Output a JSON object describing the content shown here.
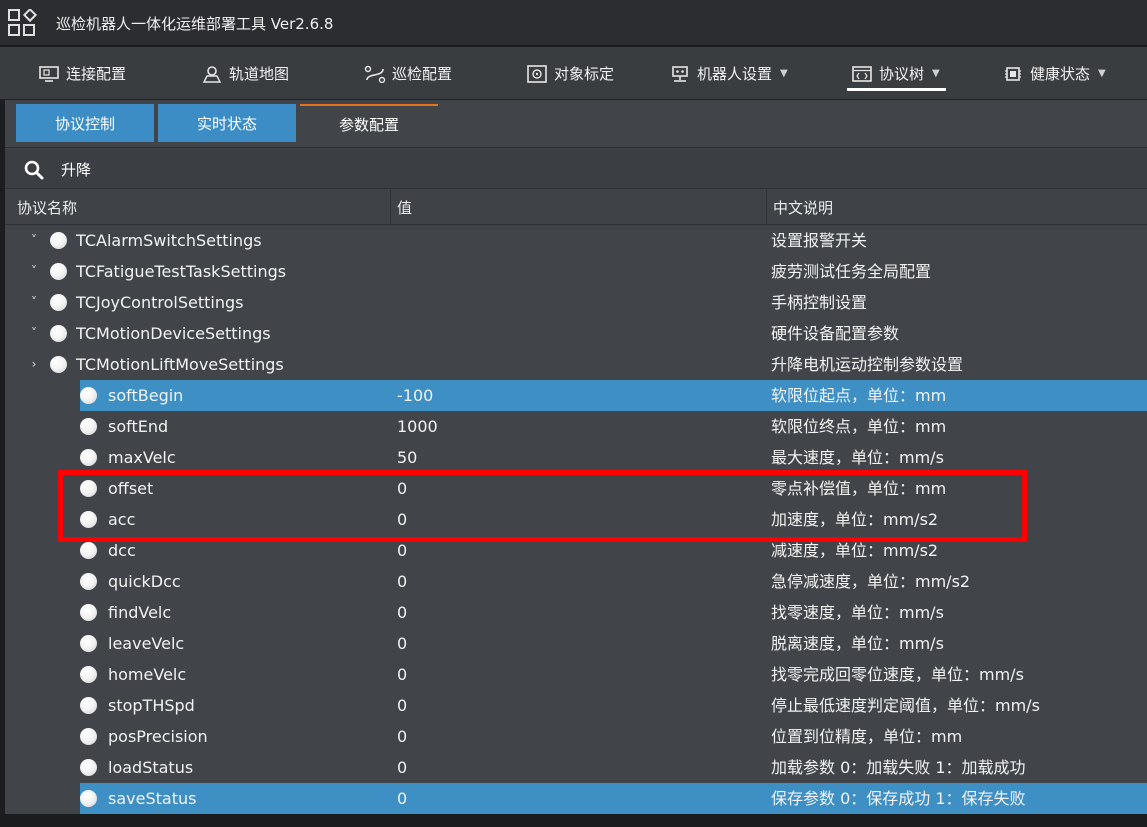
{
  "window": {
    "title": "巡检机器人一体化运维部署工具 Ver2.6.8"
  },
  "nav": [
    {
      "label": "连接配置",
      "icon": "monitor-icon",
      "dropdown": false,
      "active": false
    },
    {
      "label": "轨道地图",
      "icon": "map-pin-icon",
      "dropdown": false,
      "active": false
    },
    {
      "label": "巡检配置",
      "icon": "route-icon",
      "dropdown": false,
      "active": false
    },
    {
      "label": "对象标定",
      "icon": "target-icon",
      "dropdown": false,
      "active": false
    },
    {
      "label": "机器人设置",
      "icon": "robot-icon",
      "dropdown": true,
      "active": false
    },
    {
      "label": "协议树",
      "icon": "code-window-icon",
      "dropdown": true,
      "active": true
    },
    {
      "label": "健康状态",
      "icon": "chip-icon",
      "dropdown": true,
      "active": false
    }
  ],
  "subtabs": [
    {
      "label": "协议控制"
    },
    {
      "label": "实时状态"
    },
    {
      "label": "参数配置"
    }
  ],
  "search": {
    "value": "升降",
    "placeholder": ""
  },
  "table": {
    "headers": {
      "name": "协议名称",
      "value": "值",
      "desc": "中文说明"
    },
    "rows": [
      {
        "level": 0,
        "expand": "˅",
        "name": "TCAlarmSwitchSettings",
        "value": "",
        "desc": "设置报警开关"
      },
      {
        "level": 0,
        "expand": "˅",
        "name": "TCFatigueTestTaskSettings",
        "value": "",
        "desc": "疲劳测试任务全局配置"
      },
      {
        "level": 0,
        "expand": "˅",
        "name": "TCJoyControlSettings",
        "value": "",
        "desc": "手柄控制设置"
      },
      {
        "level": 0,
        "expand": "˅",
        "name": "TCMotionDeviceSettings",
        "value": "",
        "desc": "硬件设备配置参数"
      },
      {
        "level": 0,
        "expand": "›",
        "name": "TCMotionLiftMoveSettings",
        "value": "",
        "desc": "升降电机运动控制参数设置"
      },
      {
        "level": 1,
        "name": "softBegin",
        "value": "-100",
        "desc": "软限位起点，单位：mm",
        "selected": true
      },
      {
        "level": 1,
        "name": "softEnd",
        "value": "1000",
        "desc": "软限位终点，单位：mm"
      },
      {
        "level": 1,
        "name": "maxVelc",
        "value": "50",
        "desc": "最大速度，单位：mm/s"
      },
      {
        "level": 1,
        "name": "offset",
        "value": "0",
        "desc": "零点补偿值，单位：mm"
      },
      {
        "level": 1,
        "name": "acc",
        "value": "0",
        "desc": "加速度，单位：mm/s2"
      },
      {
        "level": 1,
        "name": "dcc",
        "value": "0",
        "desc": "减速度，单位：mm/s2"
      },
      {
        "level": 1,
        "name": "quickDcc",
        "value": "0",
        "desc": "急停减速度，单位：mm/s2"
      },
      {
        "level": 1,
        "name": "findVelc",
        "value": "0",
        "desc": "找零速度，单位：mm/s"
      },
      {
        "level": 1,
        "name": "leaveVelc",
        "value": "0",
        "desc": "脱离速度，单位：mm/s"
      },
      {
        "level": 1,
        "name": "homeVelc",
        "value": "0",
        "desc": "找零完成回零位速度，单位：mm/s"
      },
      {
        "level": 1,
        "name": "stopTHSpd",
        "value": "0",
        "desc": "停止最低速度判定阈值，单位：mm/s"
      },
      {
        "level": 1,
        "name": "posPrecision",
        "value": "0",
        "desc": "位置到位精度，单位：mm"
      },
      {
        "level": 1,
        "name": "loadStatus",
        "value": "0",
        "desc": "加载参数 0：加载失败 1：加载成功"
      },
      {
        "level": 1,
        "name": "saveStatus",
        "value": "0",
        "desc": "保存参数 0：保存成功 1：保存失败",
        "selected": true
      }
    ]
  },
  "colors": {
    "accent_blue": "#3c8dc6",
    "selection": "#3d8fc4",
    "tab_underline": "#e2731a",
    "highlight_box": "#ff0000"
  }
}
